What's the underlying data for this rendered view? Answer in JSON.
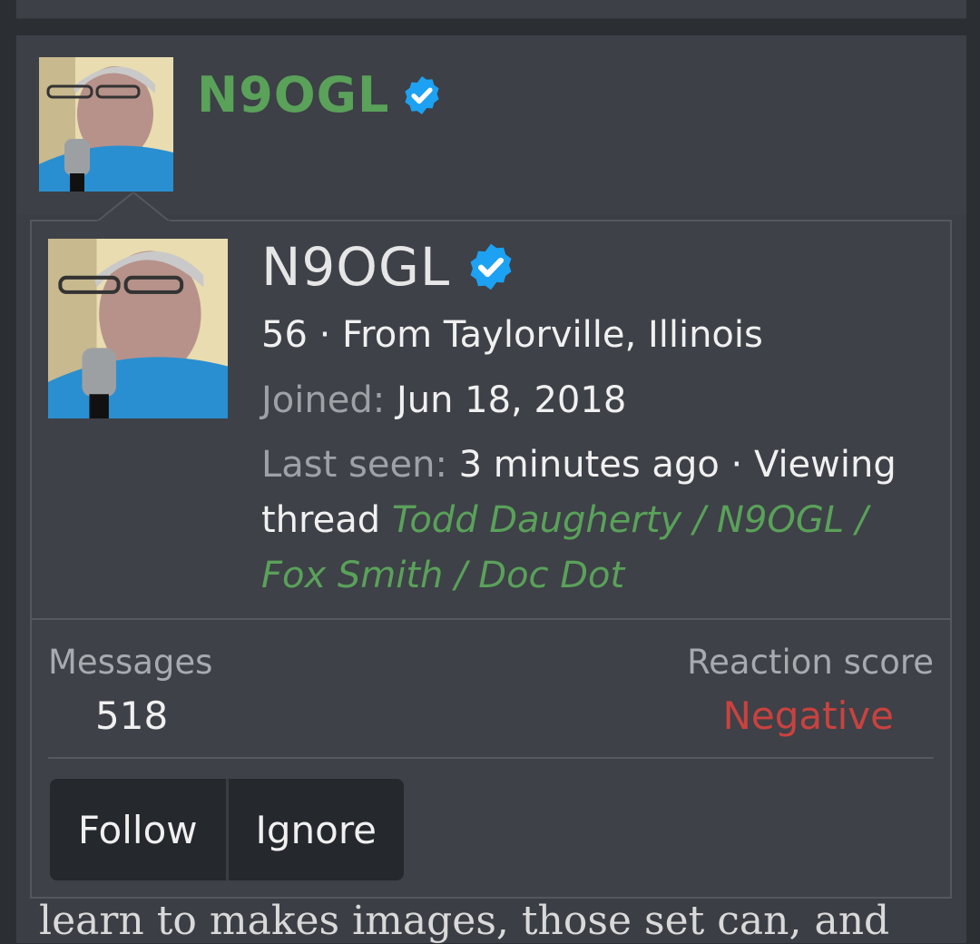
{
  "post": {
    "username": "N9OGL",
    "verified_icon": "verified-check-icon",
    "body_text_partial": "learn to makes images, those set can, and"
  },
  "profile_popup": {
    "username": "N9OGL",
    "verified_icon": "verified-check-icon",
    "age_location": "56 · From Taylorville, Illinois",
    "joined_label": "Joined:",
    "joined_value": "Jun 18, 2018",
    "last_seen_label": "Last seen:",
    "last_seen_value": "3 minutes ago · Viewing thread",
    "thread_link": "Todd Daugherty / N9OGL / Fox Smith / Doc Dot",
    "stats": {
      "messages_label": "Messages",
      "messages_value": "518",
      "reaction_label": "Reaction score",
      "reaction_value": "Negative"
    },
    "buttons": {
      "follow": "Follow",
      "ignore": "Ignore"
    }
  },
  "colors": {
    "username_green": "#5aa15a",
    "verified_blue": "#1da1f2",
    "negative_red": "#c9423f",
    "background": "#2b2e33"
  }
}
